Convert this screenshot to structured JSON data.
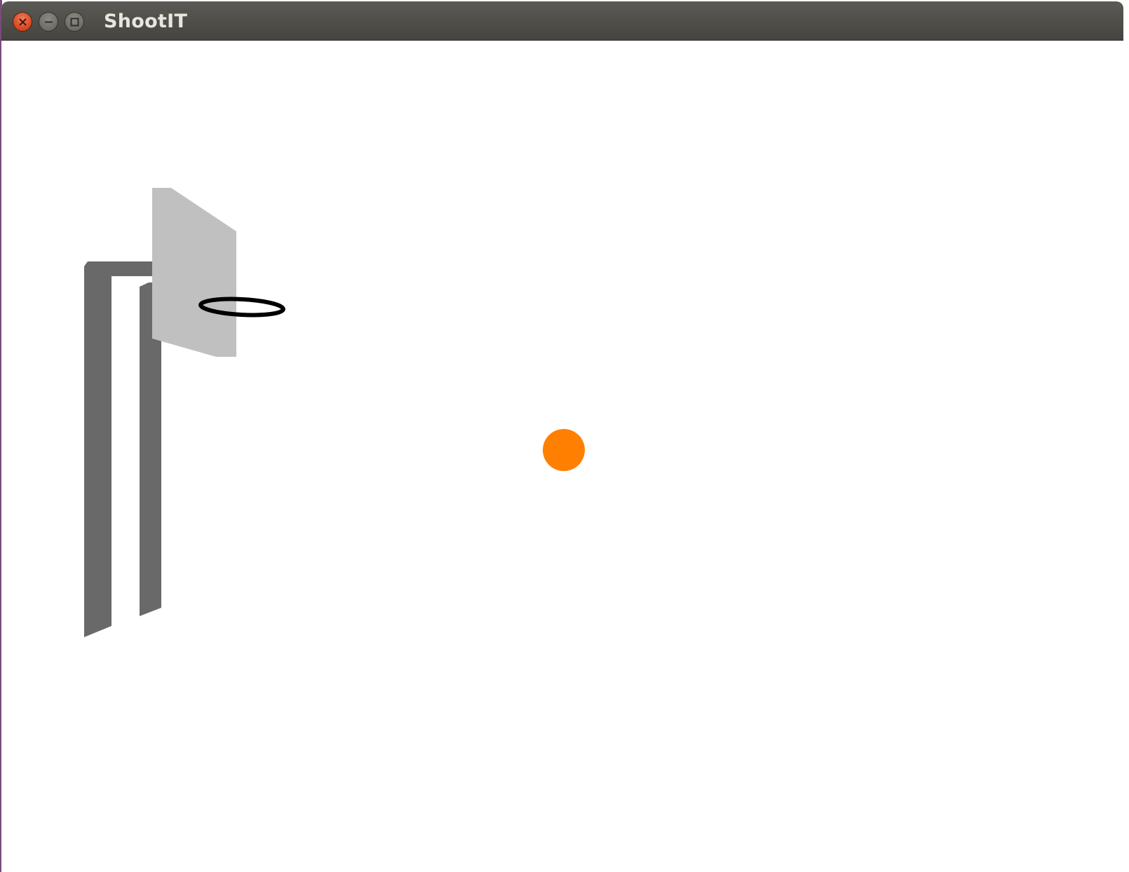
{
  "window": {
    "title": "ShootIT"
  },
  "colors": {
    "ball": "#ff7f00",
    "backboard": "#c0c0c0",
    "pole": "#696969",
    "rim": "#000000",
    "background": "#ffffff"
  }
}
